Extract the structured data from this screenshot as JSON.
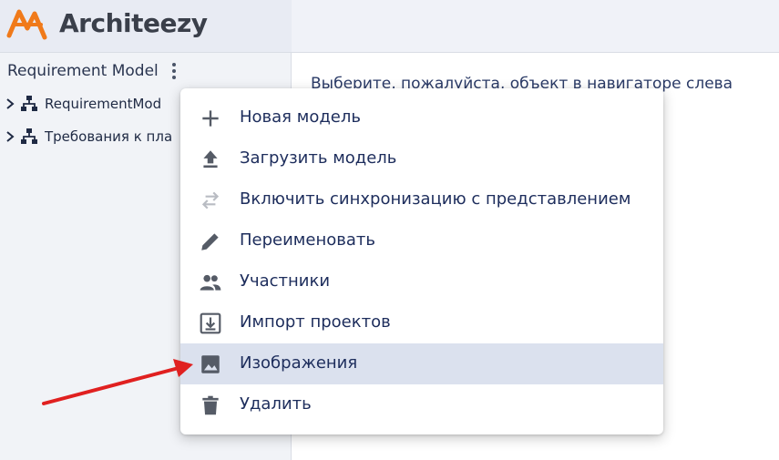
{
  "app": {
    "name": "Architeezy",
    "accent_color": "#f07a1a"
  },
  "sidebar": {
    "model_title": "Requirement Model",
    "menu_icon": "kebab-icon",
    "tree": [
      {
        "label": "RequirementMod",
        "icon": "hierarchy-icon"
      },
      {
        "label": "Требования к пла",
        "icon": "hierarchy-icon"
      }
    ]
  },
  "main": {
    "hint": "Выберите, пожалуйста, объект в навигаторе слева"
  },
  "context_menu": {
    "items": [
      {
        "label": "Новая модель",
        "icon": "plus-icon"
      },
      {
        "label": "Загрузить модель",
        "icon": "upload-icon"
      },
      {
        "label": "Включить синхронизацию с представлением",
        "icon": "sync-icon"
      },
      {
        "label": "Переименовать",
        "icon": "pencil-icon"
      },
      {
        "label": "Участники",
        "icon": "people-icon"
      },
      {
        "label": "Импорт проектов",
        "icon": "import-icon"
      },
      {
        "label": "Изображения",
        "icon": "image-icon",
        "highlighted": true
      },
      {
        "label": "Удалить",
        "icon": "trash-icon"
      }
    ],
    "highlight_color": "#dbe1ee"
  },
  "annotation": {
    "arrow_color": "#e02020",
    "points_to": "Изображения"
  }
}
